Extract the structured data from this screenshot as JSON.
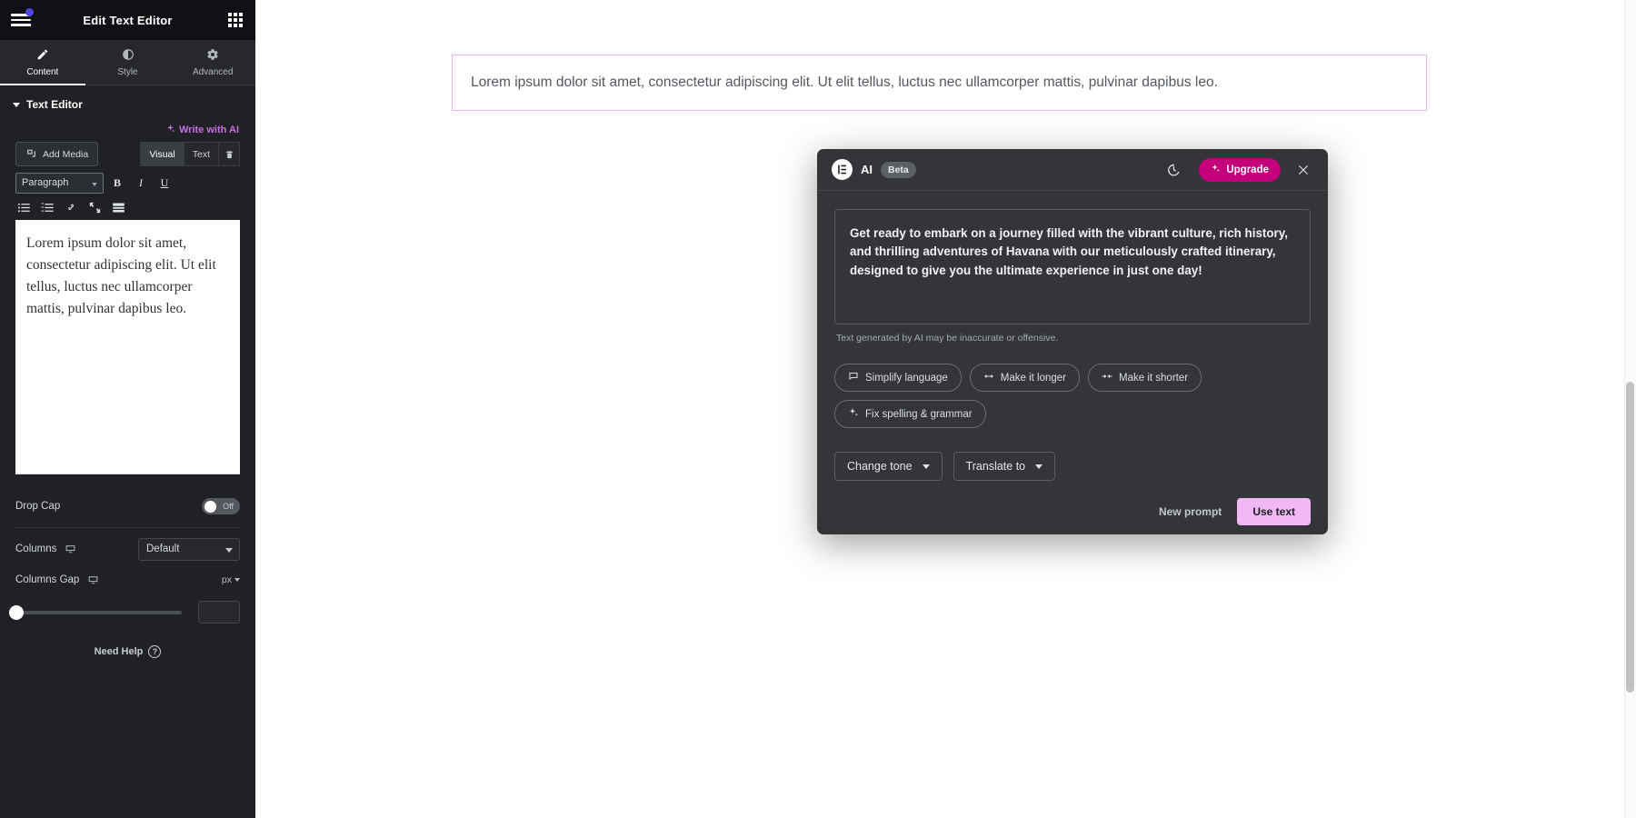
{
  "panel": {
    "header": {
      "title": "Edit Text Editor",
      "menu_icon": "hamburger-icon",
      "apps_icon": "grid-apps-icon"
    },
    "tabs": [
      {
        "label": "Content",
        "icon": "pencil-icon",
        "active": true
      },
      {
        "label": "Style",
        "icon": "contrast-circle-icon",
        "active": false
      },
      {
        "label": "Advanced",
        "icon": "gear-icon",
        "active": false
      }
    ],
    "section": {
      "title": "Text Editor"
    },
    "write_with_ai": {
      "label": "Write with AI",
      "icon": "sparkle-icon",
      "color": "#c96fe8"
    },
    "wp_editor": {
      "add_media": "Add Media",
      "mode_tabs": [
        "Visual",
        "Text"
      ],
      "mode_selected": "Visual",
      "trash_icon": "trash-icon",
      "format_select": "Paragraph",
      "format_buttons": [
        "B",
        "I",
        "U"
      ],
      "row3_icons": [
        "bulleted-list-icon",
        "numbered-list-icon",
        "link-icon",
        "fullscreen-icon",
        "table-icon"
      ],
      "content": "Lorem ipsum dolor sit amet, consectetur adipiscing elit. Ut elit tellus, luctus nec ullamcorper mattis, pulvinar dapibus leo."
    },
    "controls": {
      "drop_cap": {
        "label": "Drop Cap",
        "state": "Off"
      },
      "columns": {
        "label": "Columns",
        "value": "Default",
        "device_icon": "desktop-icon"
      },
      "columns_gap": {
        "label": "Columns Gap",
        "unit": "px",
        "value": "",
        "device_icon": "desktop-icon"
      }
    },
    "need_help": {
      "label": "Need Help",
      "icon": "question-mark-icon"
    },
    "collapse_handle": {
      "icon": "chevron-left-icon"
    }
  },
  "canvas": {
    "text_widget": {
      "content": "Lorem ipsum dolor sit amet, consectetur adipiscing elit. Ut elit tellus, luctus nec ullamcorper mattis, pulvinar dapibus leo.",
      "border_color": "#e9b8ec"
    }
  },
  "modal": {
    "header": {
      "brand_icon": "elementor-logo-icon",
      "title": "AI",
      "badge": "Beta",
      "history_icon": "history-clock-icon",
      "upgrade": {
        "label": "Upgrade",
        "icon": "sparkle-icon",
        "color": "#c4007a"
      },
      "close_icon": "close-icon"
    },
    "result": {
      "text": "Get ready to embark on a journey filled with the vibrant culture, rich history, and thrilling adventures of Havana with our meticulously crafted itinerary, designed to give you the ultimate experience in just one day!",
      "disclaimer": "Text generated by AI may be inaccurate or offensive."
    },
    "chips": [
      {
        "label": "Simplify language",
        "icon": "speech-bubble-icon"
      },
      {
        "label": "Make it longer",
        "icon": "arrows-expand-icon"
      },
      {
        "label": "Make it shorter",
        "icon": "arrows-collapse-icon"
      },
      {
        "label": "Fix spelling & grammar",
        "icon": "sparkle-icon"
      }
    ],
    "dropdowns": [
      {
        "label": "Change tone",
        "icon": "chevron-down-icon"
      },
      {
        "label": "Translate to",
        "icon": "chevron-down-icon"
      }
    ],
    "footer": {
      "new_prompt": "New prompt",
      "use_text": "Use text",
      "use_text_color": "#f0b9f5"
    }
  }
}
